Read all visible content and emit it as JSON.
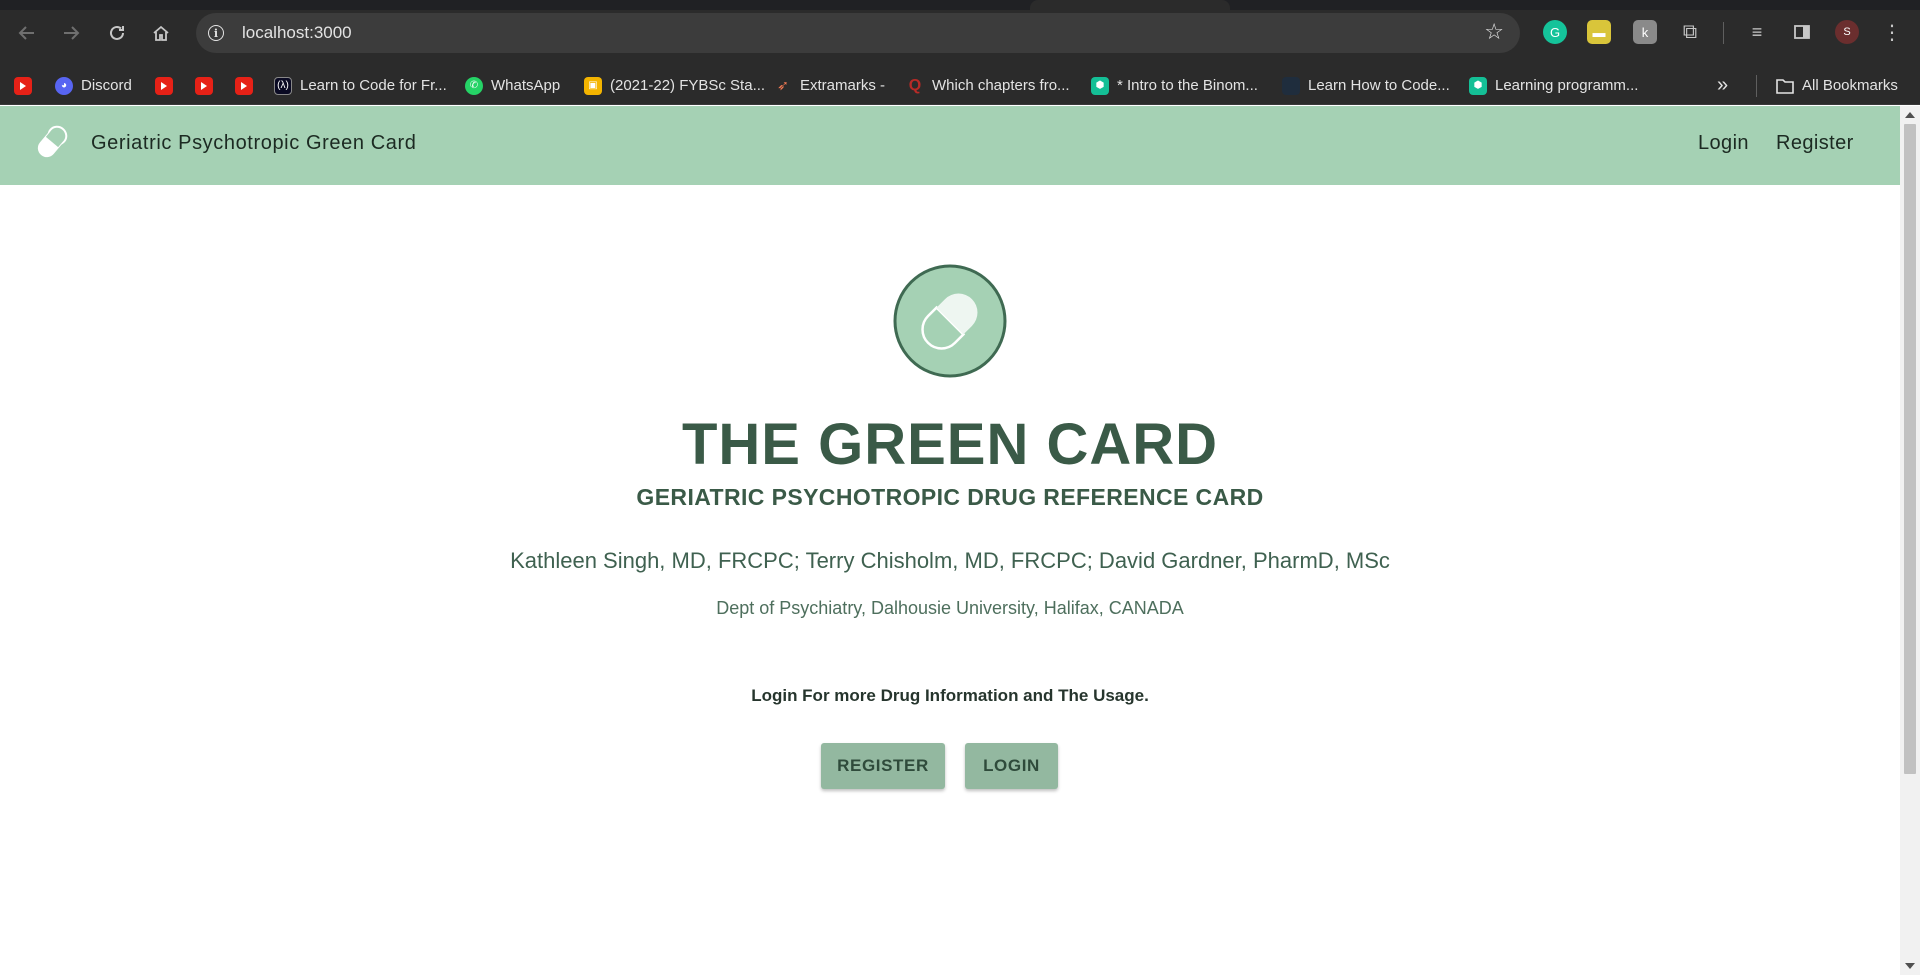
{
  "browser": {
    "url": "localhost:3000",
    "profile_initial": "S",
    "bookmarks": [
      {
        "label": "",
        "icon": "youtube-icon"
      },
      {
        "label": "Discord",
        "icon": "discord-icon"
      },
      {
        "label": "",
        "icon": "youtube-icon"
      },
      {
        "label": "",
        "icon": "youtube-icon"
      },
      {
        "label": "",
        "icon": "youtube-icon"
      },
      {
        "label": "Learn to Code for Fr...",
        "icon": "freecodecamp-icon"
      },
      {
        "label": "WhatsApp",
        "icon": "whatsapp-icon"
      },
      {
        "label": "(2021-22) FYBSc Sta...",
        "icon": "classroom-icon"
      },
      {
        "label": "Extramarks -",
        "icon": "extramarks-icon"
      },
      {
        "label": "Which chapters fro...",
        "icon": "quora-icon"
      },
      {
        "label": "* Intro to the Binom...",
        "icon": "khan-academy-icon"
      },
      {
        "label": "Learn How to Code...",
        "icon": "site-icon"
      },
      {
        "label": "Learning programm...",
        "icon": "khan-academy-icon"
      }
    ],
    "all_bookmarks_label": "All Bookmarks",
    "colors": {
      "chrome_bg": "#2b2b2b",
      "omnibox_bg": "#3c3c3c"
    }
  },
  "appbar": {
    "brand": "Geriatric Psychotropic Green Card",
    "login_label": "Login",
    "register_label": "Register",
    "color": "#a5d1b4"
  },
  "hero": {
    "title": "THE GREEN CARD",
    "subtitle": "GERIATRIC PSYCHOTROPIC DRUG REFERENCE CARD",
    "authors": "Kathleen Singh, MD, FRCPC; Terry Chisholm, MD, FRCPC; David Gardner, PharmD, MSc",
    "department": "Dept of Psychiatry, Dalhousie University, Halifax, CANADA",
    "prompt": "Login For more Drug Information and The Usage.",
    "register_button": "REGISTER",
    "login_button": "LOGIN",
    "accent": "#3a5a47",
    "button_color": "#93b8a0"
  }
}
